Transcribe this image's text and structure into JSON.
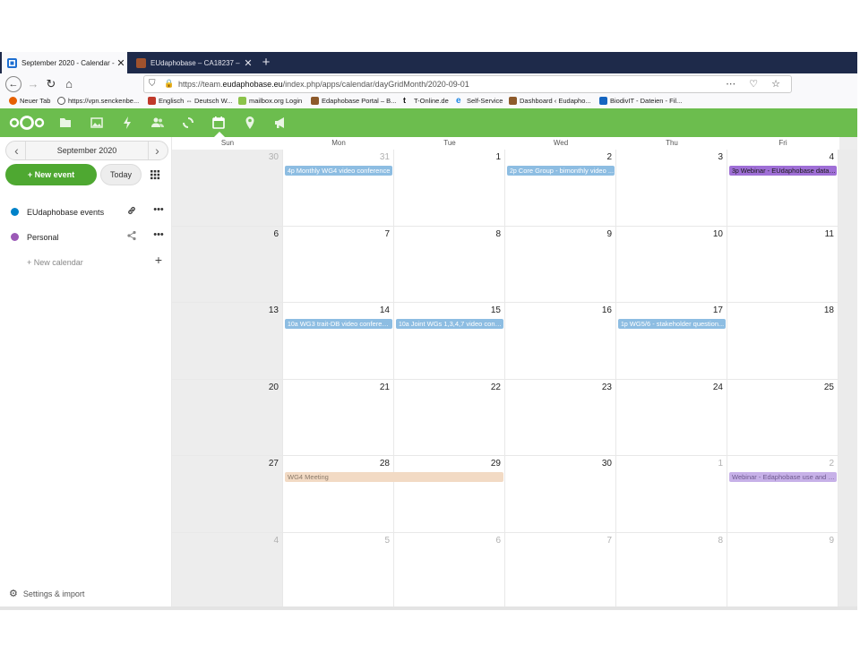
{
  "browser": {
    "tabs": [
      {
        "title": "September 2020 - Calendar - EU",
        "close": "✕"
      },
      {
        "title": "EUdaphobase – CA18237 – Euro",
        "close": "✕"
      }
    ],
    "new_tab": "+",
    "url_prefix": "https://team.",
    "url_domain": "eudaphobase.eu",
    "url_path": "/index.php/apps/calendar/dayGridMonth/2020-09-01",
    "url_icons": "⋯ ♡ ☆",
    "bookmarks": [
      {
        "label": "Neuer Tab",
        "color": "#e66000"
      },
      {
        "label": "https://vpn.senckenbe...",
        "color": "#555555"
      },
      {
        "label": "Englisch ⇔ Deutsch W...",
        "color": "#c0392b"
      },
      {
        "label": "mailbox.org Login",
        "color": "#8bc34a"
      },
      {
        "label": "Edaphobase Portal – B...",
        "color": "#8d5a2b"
      },
      {
        "label": "T-Online.de",
        "color": "#e20074"
      },
      {
        "label": "Self-Service",
        "color": "#1e88e5"
      },
      {
        "label": "Dashboard ‹ Eudapho...",
        "color": "#8d5a2b"
      },
      {
        "label": "BiodivIT - Dateien - Fil...",
        "color": "#1565c0"
      }
    ]
  },
  "colors": {
    "header": "#6cbd4e",
    "primary": "#4ea831",
    "eudaphobase_calendar": "#0082c9",
    "personal_calendar": "#9b59b6",
    "event_blue": "#8dbde2",
    "event_purple": "#9f6fd6",
    "event_beige": "#f2dac4",
    "event_lilac": "#c7b1e8"
  },
  "sidebar": {
    "month_label": "September 2020",
    "prev": "‹",
    "next": "›",
    "new_event_label": "+ New event",
    "today_label": "Today",
    "calendars": [
      {
        "name": "EUdaphobase events",
        "color": "#0082c9",
        "action_icon": "link-icon",
        "action_glyph": "🔗",
        "more": "•••"
      },
      {
        "name": "Personal",
        "color": "#9b59b6",
        "action_icon": "share-icon",
        "action_glyph": "⋖",
        "more": "•••"
      }
    ],
    "new_calendar_label": "+ New calendar",
    "new_calendar_plus": "+",
    "settings_label": "Settings & import"
  },
  "calendar": {
    "day_names": [
      "Sun",
      "Mon",
      "Tue",
      "Wed",
      "Thu",
      "Fri"
    ],
    "weeks": [
      [
        {
          "d": "30",
          "o": true
        },
        {
          "d": "31",
          "o": true
        },
        {
          "d": "1"
        },
        {
          "d": "2"
        },
        {
          "d": "3"
        },
        {
          "d": "4"
        }
      ],
      [
        {
          "d": "6"
        },
        {
          "d": "7"
        },
        {
          "d": "8"
        },
        {
          "d": "9"
        },
        {
          "d": "10"
        },
        {
          "d": "11"
        }
      ],
      [
        {
          "d": "13"
        },
        {
          "d": "14"
        },
        {
          "d": "15"
        },
        {
          "d": "16"
        },
        {
          "d": "17"
        },
        {
          "d": "18"
        }
      ],
      [
        {
          "d": "20"
        },
        {
          "d": "21"
        },
        {
          "d": "22"
        },
        {
          "d": "23"
        },
        {
          "d": "24"
        },
        {
          "d": "25"
        }
      ],
      [
        {
          "d": "27"
        },
        {
          "d": "28"
        },
        {
          "d": "29"
        },
        {
          "d": "30"
        },
        {
          "d": "1",
          "o": true
        },
        {
          "d": "2",
          "o": true
        }
      ],
      [
        {
          "d": "4",
          "o": true
        },
        {
          "d": "5",
          "o": true
        },
        {
          "d": "6",
          "o": true
        },
        {
          "d": "7",
          "o": true
        },
        {
          "d": "8",
          "o": true
        },
        {
          "d": "9",
          "o": true
        }
      ]
    ],
    "events": [
      {
        "week": 0,
        "day": 1,
        "span": 1,
        "time": "4p",
        "title": "Monthly WG4 video conference",
        "color": "#8dbde2",
        "text": "#ffffff"
      },
      {
        "week": 0,
        "day": 3,
        "span": 1,
        "time": "2p",
        "title": "Core Group - bimonthly video ...",
        "color": "#8dbde2",
        "text": "#ffffff"
      },
      {
        "week": 0,
        "day": 5,
        "span": 1,
        "time": "3p",
        "title": "Webinar - EUdaphobase data s...",
        "color": "#9f6fd6",
        "text": "#1a1a1a"
      },
      {
        "week": 2,
        "day": 1,
        "span": 1,
        "time": "10a",
        "title": "WG3 trait-DB video conference",
        "color": "#8dbde2",
        "text": "#ffffff"
      },
      {
        "week": 2,
        "day": 2,
        "span": 1,
        "time": "10a",
        "title": "Joint WGs 1,3,4,7 video confer...",
        "color": "#8dbde2",
        "text": "#ffffff"
      },
      {
        "week": 2,
        "day": 4,
        "span": 1,
        "time": "1p",
        "title": "WG5/6 - stakeholder question...",
        "color": "#8dbde2",
        "text": "#ffffff"
      },
      {
        "week": 4,
        "day": 1,
        "span": 2,
        "time": "",
        "title": "WG4 Meeting",
        "color": "#f2dac4",
        "text": "#8a7a6a"
      },
      {
        "week": 4,
        "day": 5,
        "span": 1,
        "time": "",
        "title": "Webinar - Edaphobase use and p...",
        "color": "#c7b1e8",
        "text": "#6f5a8f"
      }
    ]
  }
}
